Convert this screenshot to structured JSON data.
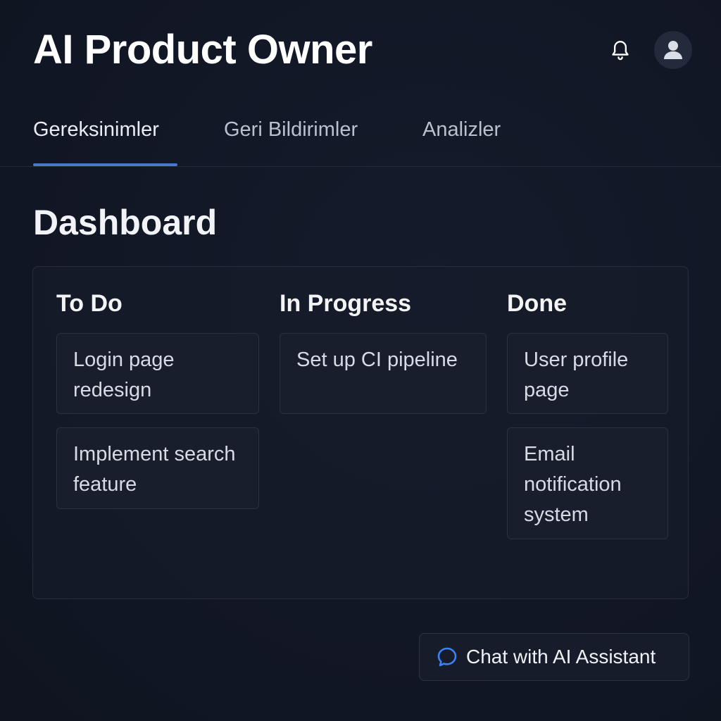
{
  "header": {
    "title": "AI Product Owner",
    "bell_icon": "bell-icon",
    "avatar_icon": "user-avatar-icon"
  },
  "tabs": [
    {
      "label": "Gereksinimler",
      "active": true
    },
    {
      "label": "Geri Bildirimler",
      "active": false
    },
    {
      "label": "Analizler",
      "active": false
    }
  ],
  "dashboard": {
    "title": "Dashboard",
    "columns": [
      {
        "title": "To Do",
        "cards": [
          "Login page redesign",
          "Implement search feature"
        ]
      },
      {
        "title": "In Progress",
        "cards": [
          "Set up CI pipeline"
        ]
      },
      {
        "title": "Done",
        "cards": [
          "User profile page",
          "Email notification system"
        ]
      }
    ]
  },
  "chat": {
    "label": "Chat with AI Assistant",
    "icon": "chat-bubble-icon"
  },
  "colors": {
    "background": "#121826",
    "accent": "#4a78c9",
    "chat_icon": "#3b82f6"
  }
}
